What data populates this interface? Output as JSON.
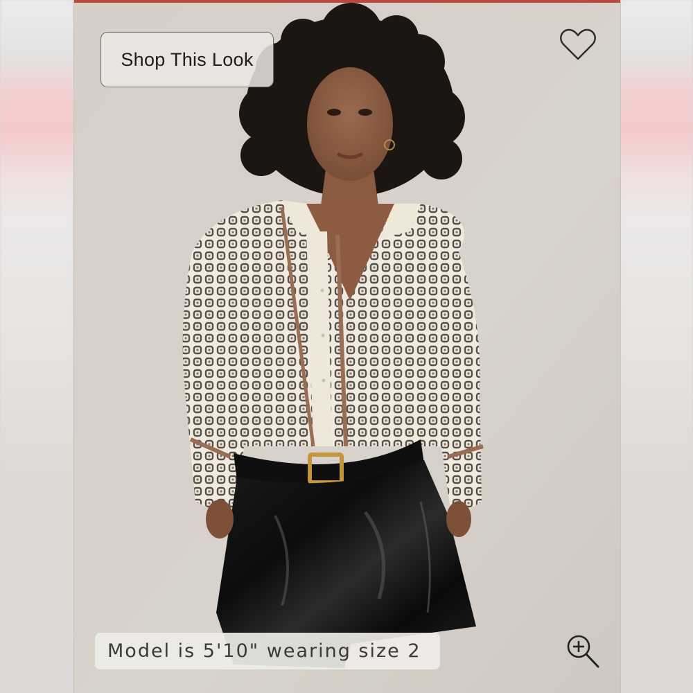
{
  "product_image": {
    "shop_look_label": "Shop This Look",
    "favorite_icon": "heart-outline-icon",
    "model_info": "Model is 5'10\" wearing size 2",
    "zoom_icon": "zoom-in-icon"
  },
  "colors": {
    "accent_rule": "#b94a3f",
    "photo_background": "#d7d1cb"
  }
}
